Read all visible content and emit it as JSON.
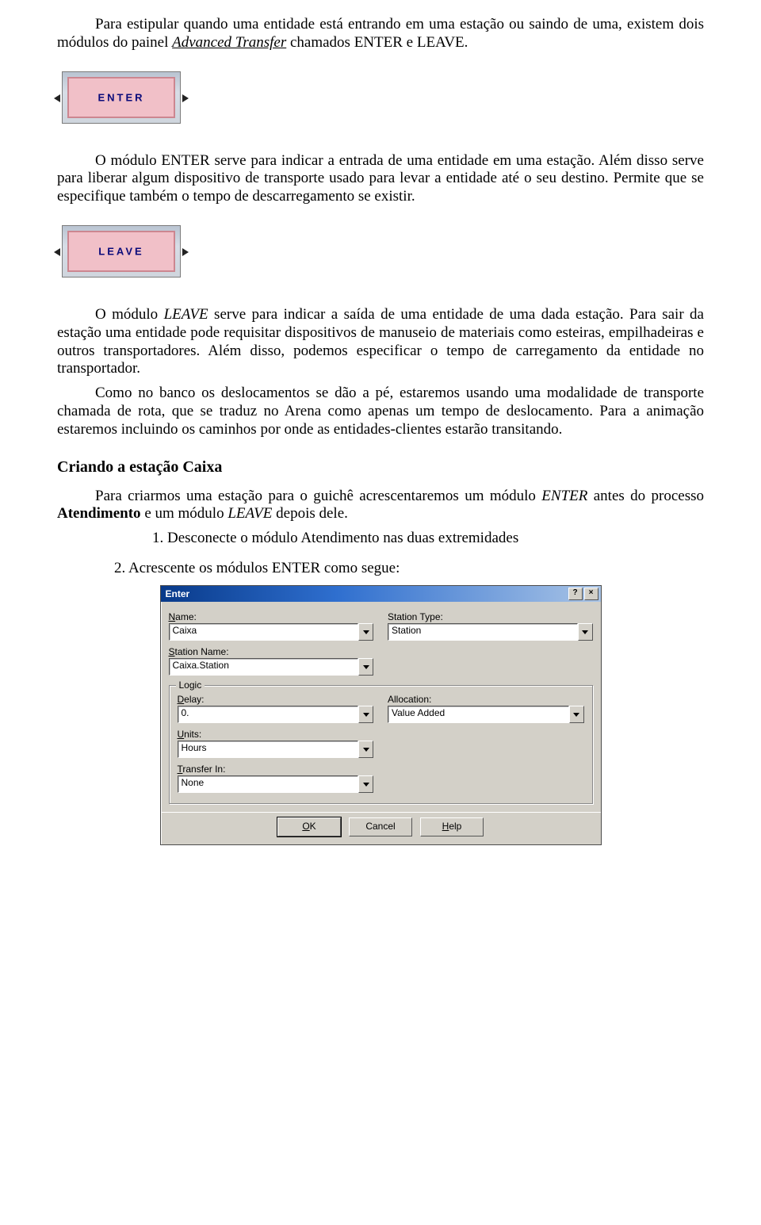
{
  "para1_a": "Para estipular quando uma entidade está entrando em uma estação ou saindo de uma, existem dois módulos do painel ",
  "para1_link": "Advanced Transfer",
  "para1_b": " chamados ENTER e LEAVE.",
  "module1_label": "ENTER",
  "para2": "O módulo ENTER serve para indicar a entrada de uma entidade em uma estação. Além disso serve para liberar algum dispositivo de transporte usado para levar a entidade até o seu destino. Permite que se especifique também o tempo de descarregamento se existir.",
  "module2_label": "LEAVE",
  "para3_a": "O módulo ",
  "para3_i": "LEAVE",
  "para3_b": " serve para indicar a saída de uma entidade de uma dada estação. Para sair da estação uma entidade pode requisitar dispositivos de manuseio de materiais como esteiras, empilhadeiras e outros transportadores. Além disso, podemos especificar o tempo de carregamento da entidade no transportador.",
  "para4": "Como no banco os deslocamentos se dão a pé, estaremos usando uma modalidade de transporte chamada de rota, que se traduz no Arena como apenas um tempo de deslocamento. Para a animação estaremos incluindo os caminhos por onde as entidades-clientes estarão transitando.",
  "subhead": "Criando a estação Caixa",
  "para5_a": "Para criarmos uma estação para o guichê acrescentaremos um módulo ",
  "para5_i1": "ENTER",
  "para5_b": " antes do processo ",
  "para5_bold": "Atendimento",
  "para5_c": " e um módulo ",
  "para5_i2": "LEAVE",
  "para5_d": " depois dele.",
  "step1": "1. Desconecte o módulo Atendimento nas duas extremidades",
  "step2": "2.  Acrescente os módulos ENTER como segue:",
  "dialog": {
    "title": "Enter",
    "help_icon": "?",
    "close_icon": "×",
    "labels": {
      "name": "Name:",
      "station_type": "Station Type:",
      "station_name": "Station Name:",
      "logic": "Logic",
      "delay": "Delay:",
      "allocation": "Allocation:",
      "units": "Units:",
      "transfer_in": "Transfer In:"
    },
    "values": {
      "name": "Caixa",
      "station_type": "Station",
      "station_name": "Caixa.Station",
      "delay": "0.",
      "allocation": "Value Added",
      "units": "Hours",
      "transfer_in": "None"
    },
    "buttons": {
      "ok": "OK",
      "cancel": "Cancel",
      "help": "Help"
    }
  }
}
